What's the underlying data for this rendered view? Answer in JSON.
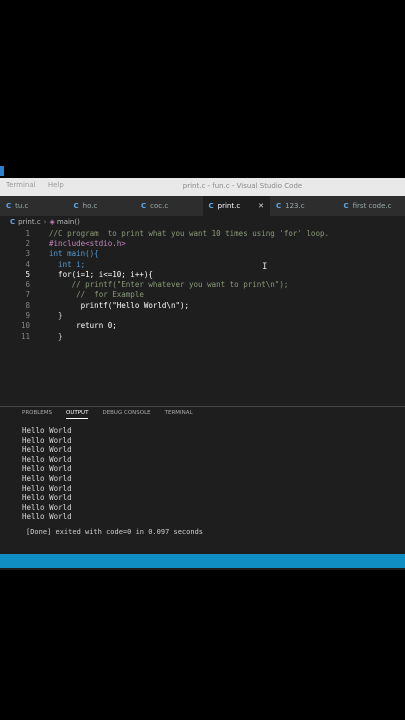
{
  "window": {
    "title": "print.c - fun.c - Visual Studio Code",
    "menu": [
      "Terminal",
      "Help"
    ]
  },
  "tabs": [
    {
      "label": "tu.c",
      "active": false
    },
    {
      "label": "ho.c",
      "active": false
    },
    {
      "label": "coc.c",
      "active": false
    },
    {
      "label": "print.c",
      "active": true
    },
    {
      "label": "123.c",
      "active": false
    },
    {
      "label": "first code.c",
      "active": false
    }
  ],
  "breadcrumb": {
    "file": "print.c",
    "symbol": "main()"
  },
  "editor": {
    "lines": [
      {
        "n": "1",
        "text": "  //C program  to print what you want 10 times using 'for' loop."
      },
      {
        "n": "2",
        "text": "  #include<stdio.h>"
      },
      {
        "n": "3",
        "text": "  int main(){"
      },
      {
        "n": "4",
        "text": "    int i;"
      },
      {
        "n": "5",
        "text": "    for(i=1; i<=10; i++){"
      },
      {
        "n": "6",
        "text": "       // printf(\"Enter whatever you want to print\\n\");"
      },
      {
        "n": "7",
        "text": "        //  for Example"
      },
      {
        "n": "8",
        "text": "         printf(\"Hello World\\n\");"
      },
      {
        "n": "9",
        "text": "    }"
      },
      {
        "n": "10",
        "text": "        return 0;"
      },
      {
        "n": "11",
        "text": "    }"
      }
    ]
  },
  "panel": {
    "tabs": [
      "PROBLEMS",
      "OUTPUT",
      "DEBUG CONSOLE",
      "TERMINAL"
    ],
    "active_tab": "OUTPUT",
    "output_lines": [
      "Hello World",
      "Hello World",
      "Hello World",
      "Hello World",
      "Hello World",
      "Hello World",
      "Hello World",
      "Hello World",
      "Hello World",
      "Hello World"
    ],
    "done_message": "[Done] exited with code=0 in 0.097 seconds"
  },
  "colors": {
    "statusbar": "#0f8fc4",
    "accent": "#5fa8e8"
  }
}
